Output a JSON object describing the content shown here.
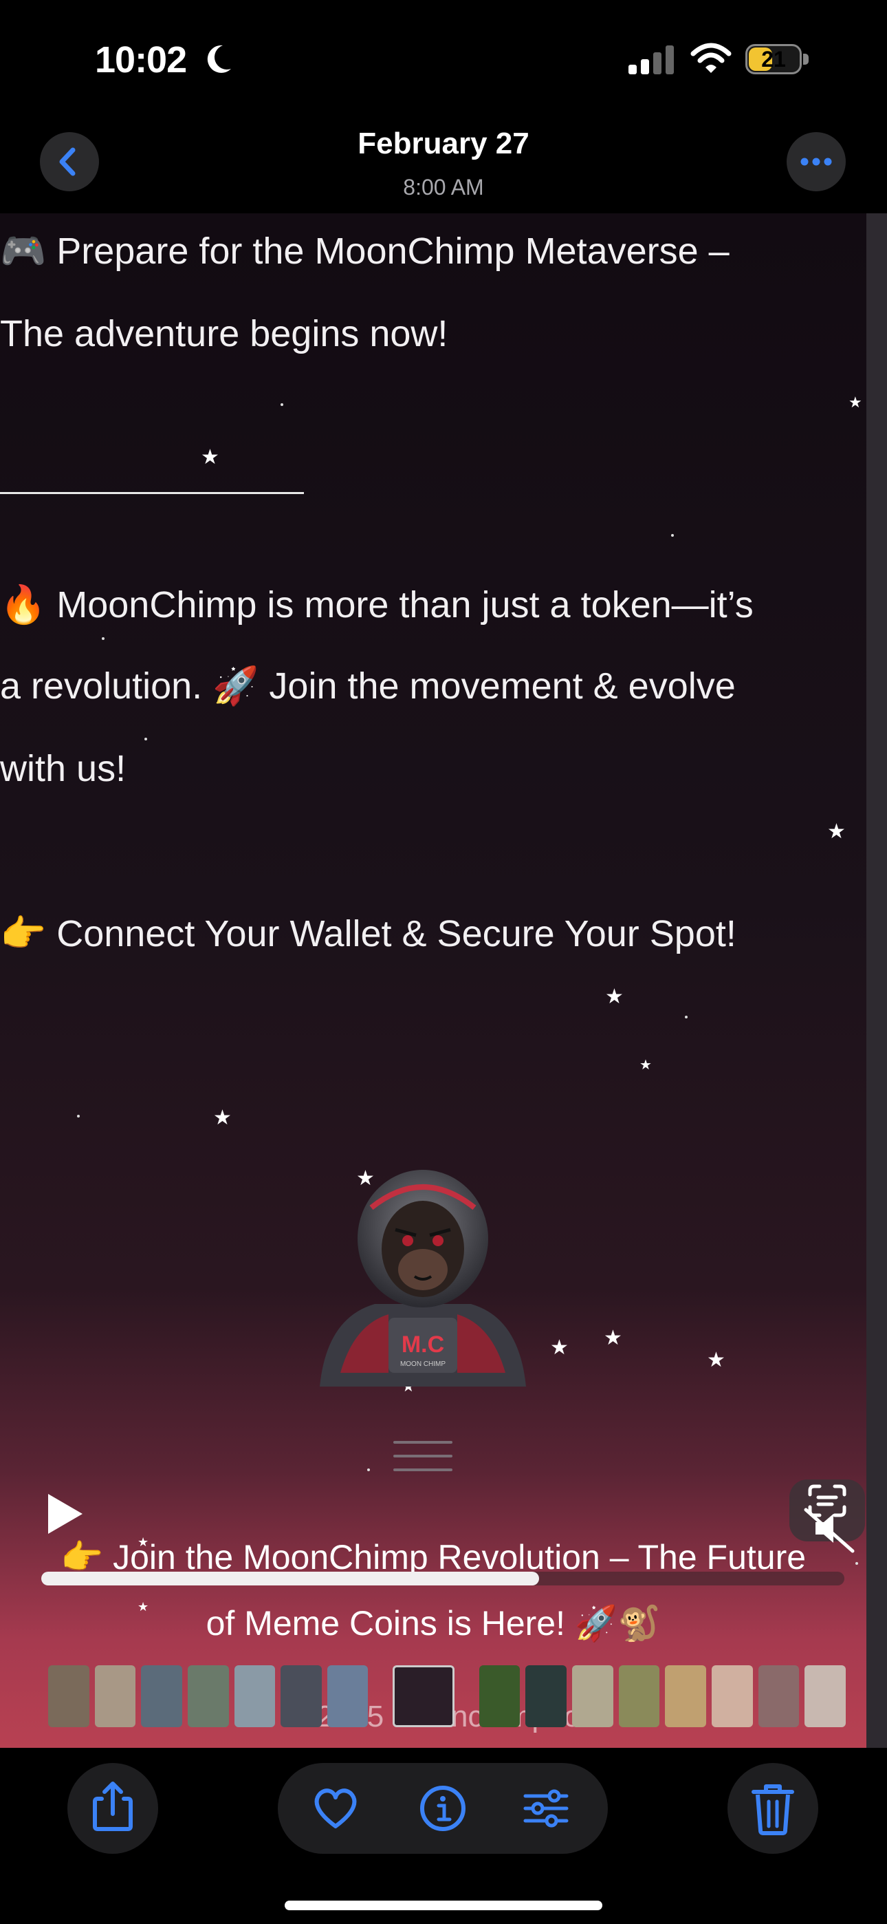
{
  "status_bar": {
    "time": "10:02",
    "battery": "21"
  },
  "header": {
    "title": "February 27",
    "subtitle": "8:00 AM"
  },
  "content": {
    "line1": "🎮 Prepare for the MoonChimp Metaverse –",
    "line2": "The adventure begins now!",
    "line3": "🔥 MoonChimp is more than just a token—it’s",
    "line4": "a revolution. 🚀 Join the movement & evolve",
    "line5": "with us!",
    "line6": "👉 Connect Your Wallet & Secure Your Spot!",
    "logo_text": "M.C",
    "logo_sub": "MOON CHIMP",
    "join_line1": "👉 Join the MoonChimp Revolution – The Future",
    "join_line2": "of Meme Coins is Here! 🚀🐒",
    "footer": "© 2025 moonchimp.io"
  },
  "video": {
    "progress": 0.62
  },
  "colors": {
    "accent": "#3b82f6",
    "bg": "#000000",
    "gradient_bottom": "#b84152"
  },
  "toolbar": {
    "share": "share-icon",
    "favorite": "heart-icon",
    "info": "info-icon",
    "adjust": "sliders-icon",
    "delete": "trash-icon"
  }
}
